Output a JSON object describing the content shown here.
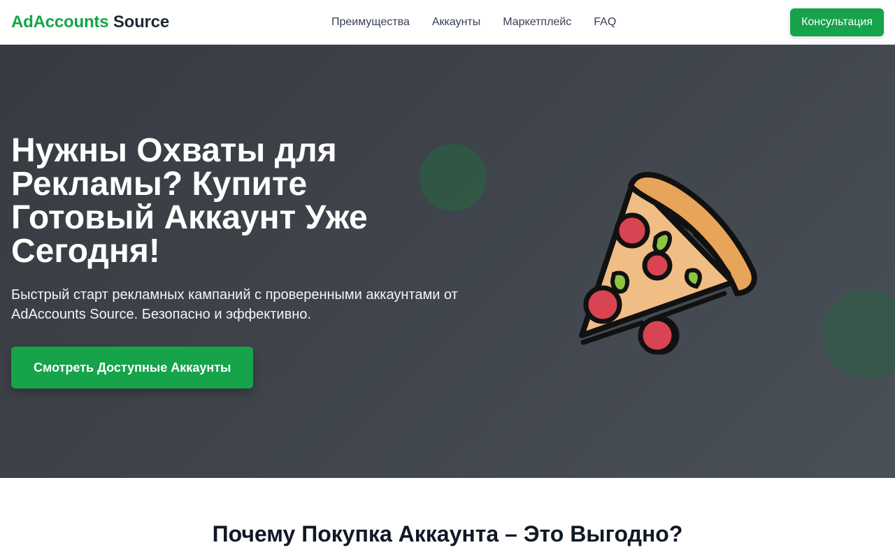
{
  "header": {
    "logo_part1": "AdAccounts",
    "logo_part2": "Source",
    "nav": [
      {
        "label": "Преимущества"
      },
      {
        "label": "Аккаунты"
      },
      {
        "label": "Маркетплейс"
      },
      {
        "label": "FAQ"
      }
    ],
    "cta_label": "Консультация"
  },
  "hero": {
    "title": "Нужны Охваты для Рекламы? Купите Готовый Аккаунт Уже Сегодня!",
    "subtitle": "Быстрый старт рекламных кампаний с проверенными аккаунтами от AdAccounts Source. Безопасно и эффективно.",
    "cta_label": "Смотреть Доступные Аккаунты",
    "illustration": "pizza-slice-icon"
  },
  "section": {
    "title": "Почему Покупка Аккаунта – Это Выгодно?"
  },
  "colors": {
    "accent": "#16a34a",
    "hero_bg": "#3f444b",
    "text_dark": "#111827"
  }
}
